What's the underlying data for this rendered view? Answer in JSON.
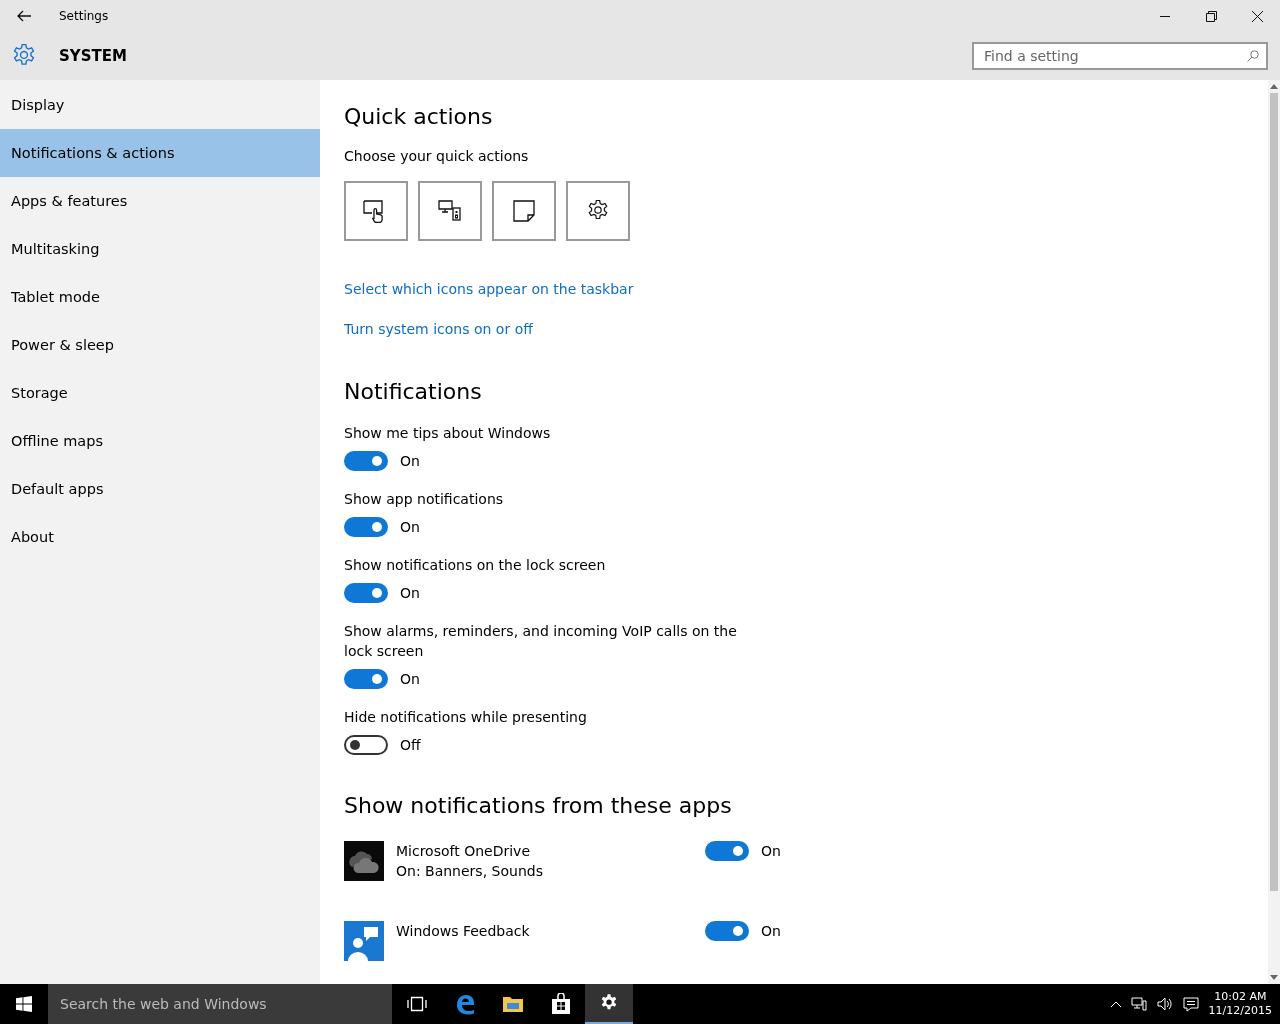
{
  "window": {
    "title": "Settings"
  },
  "header": {
    "title": "SYSTEM",
    "search": {
      "placeholder": "Find a setting"
    }
  },
  "sidebar": {
    "items": [
      {
        "label": "Display",
        "selected": false
      },
      {
        "label": "Notifications & actions",
        "selected": true
      },
      {
        "label": "Apps & features",
        "selected": false
      },
      {
        "label": "Multitasking",
        "selected": false
      },
      {
        "label": "Tablet mode",
        "selected": false
      },
      {
        "label": "Power & sleep",
        "selected": false
      },
      {
        "label": "Storage",
        "selected": false
      },
      {
        "label": "Offline maps",
        "selected": false
      },
      {
        "label": "Default apps",
        "selected": false
      },
      {
        "label": "About",
        "selected": false
      }
    ]
  },
  "quick_actions": {
    "title": "Quick actions",
    "subtitle": "Choose your quick actions",
    "tiles": [
      {
        "kind": "tablet"
      },
      {
        "kind": "connect"
      },
      {
        "kind": "note"
      },
      {
        "kind": "settings"
      }
    ],
    "links": [
      "Select which icons appear on the taskbar",
      "Turn system icons on or off"
    ]
  },
  "notifications": {
    "title": "Notifications",
    "settings": [
      {
        "label": "Show me tips about Windows",
        "on": true,
        "state": "On"
      },
      {
        "label": "Show app notifications",
        "on": true,
        "state": "On"
      },
      {
        "label": "Show notifications on the lock screen",
        "on": true,
        "state": "On"
      },
      {
        "label": "Show alarms, reminders, and incoming VoIP calls on the lock screen",
        "on": true,
        "state": "On"
      },
      {
        "label": "Hide notifications while presenting",
        "on": false,
        "state": "Off"
      }
    ]
  },
  "apps": {
    "title": "Show notifications from these apps",
    "items": [
      {
        "kind": "onedrive",
        "name": "Microsoft OneDrive",
        "detail": "On: Banners, Sounds",
        "on": true,
        "state": "On"
      },
      {
        "kind": "feedback",
        "name": "Windows Feedback",
        "on": true,
        "state": "On"
      }
    ]
  },
  "taskbar": {
    "search": {
      "placeholder": "Search the web and Windows"
    },
    "apps": [
      {
        "kind": "taskview",
        "selected": false
      },
      {
        "kind": "edge",
        "selected": false
      },
      {
        "kind": "explorer",
        "selected": false
      },
      {
        "kind": "store",
        "selected": false
      },
      {
        "kind": "settings",
        "selected": true
      }
    ],
    "time": "10:02 AM",
    "date": "11/12/2015"
  }
}
